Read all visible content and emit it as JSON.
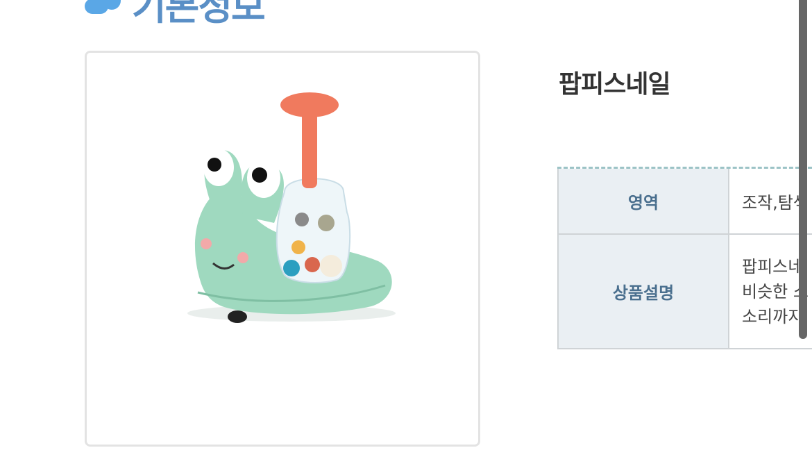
{
  "section": {
    "title": "기본정보"
  },
  "product": {
    "name": "팝피스네일",
    "image_alt": "snail toy"
  },
  "table": {
    "rows": [
      {
        "label": "영역",
        "value": "조작,탐색"
      },
      {
        "label": "상품설명",
        "lines": [
          "팝피스네",
          "비슷한 소",
          "소리까지"
        ]
      }
    ]
  },
  "colors": {
    "heading": "#5a8fc6",
    "table_head_bg": "#eaeff3",
    "dashed_border": "#9cc3c6"
  },
  "icons": {
    "heading": "cloud-icon"
  }
}
